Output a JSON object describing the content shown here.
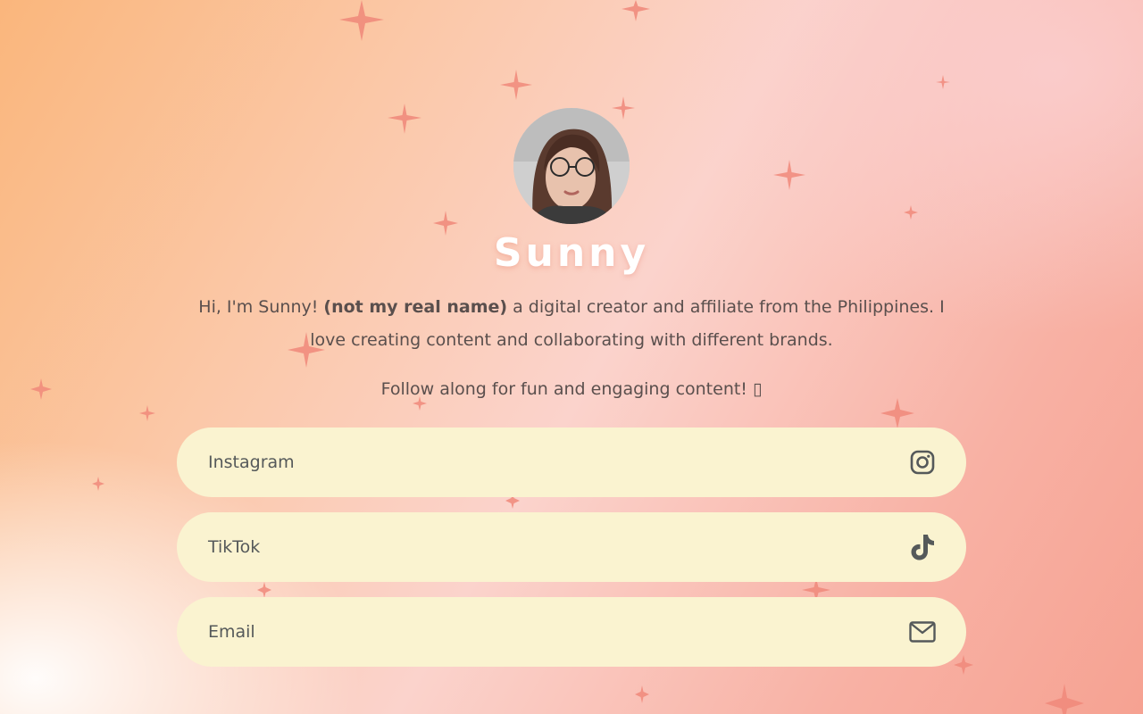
{
  "profile": {
    "name": "Sunny",
    "bio_intro": "Hi, I'm Sunny! ",
    "bio_bold": "(not my real name)",
    "bio_rest": " a digital creator and affiliate from the Philippines. I love creating content and collaborating with different brands.",
    "follow_text": "Follow along for fun and engaging content! ▯"
  },
  "links": [
    {
      "label": "Instagram",
      "icon": "instagram-icon"
    },
    {
      "label": "TikTok",
      "icon": "tiktok-icon"
    },
    {
      "label": "Email",
      "icon": "email-icon"
    }
  ],
  "colors": {
    "button_bg": "#faf3d0",
    "button_text": "#55595a",
    "sparkle": "#f08a78",
    "name_text": "#ffffff"
  }
}
